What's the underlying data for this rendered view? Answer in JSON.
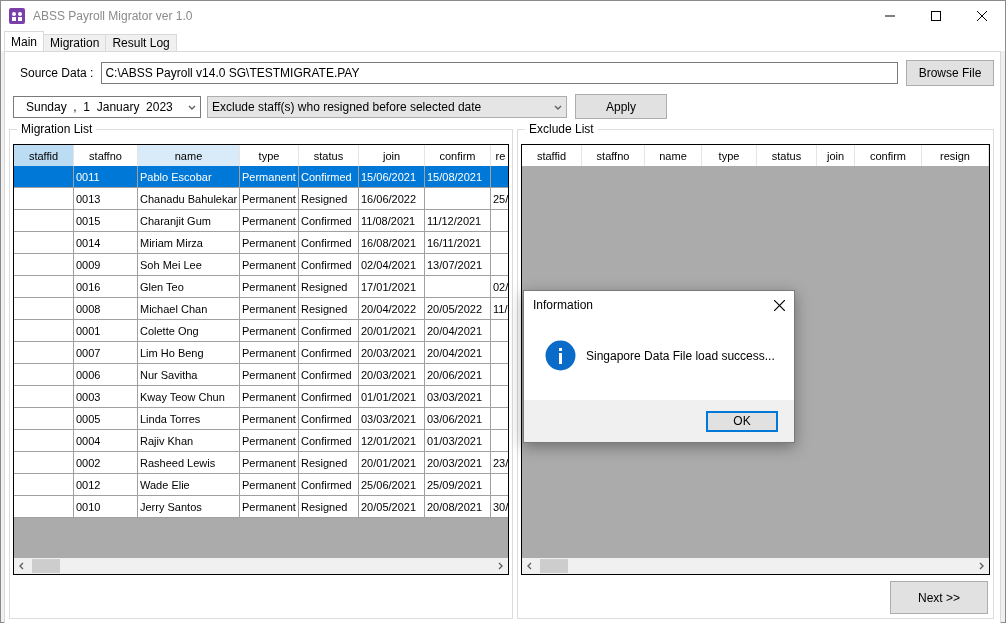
{
  "window": {
    "title": "ABSS Payroll Migrator ver 1.0"
  },
  "tabs": [
    {
      "label": "Main",
      "selected": true
    },
    {
      "label": "Migration",
      "selected": false
    },
    {
      "label": "Result Log",
      "selected": false
    }
  ],
  "source": {
    "label": "Source Data :",
    "value": "C:\\ABSS Payroll v14.0 SG\\TESTMIGRATE.PAY",
    "button": "Browse File"
  },
  "filter": {
    "date": "Sunday  ,  1  January  2023",
    "option": "Exclude staff(s) who resigned before selected date",
    "button": "Apply"
  },
  "migration_list": {
    "title": "Migration List",
    "columns": [
      {
        "label": "staffid",
        "selected": true,
        "hot": false
      },
      {
        "label": "staffno",
        "selected": false,
        "hot": false
      },
      {
        "label": "name",
        "selected": false,
        "hot": true
      },
      {
        "label": "type",
        "selected": false,
        "hot": false
      },
      {
        "label": "status",
        "selected": false,
        "hot": false
      },
      {
        "label": "join",
        "selected": false,
        "hot": false
      },
      {
        "label": "confirm",
        "selected": false,
        "hot": false
      },
      {
        "label": "re",
        "selected": false,
        "hot": false
      }
    ],
    "rows": [
      {
        "selected": true,
        "staffno": "0011",
        "name": "Pablo Escobar",
        "type": "Permanent",
        "status": "Confirmed",
        "join": "15/06/2021",
        "confirm": "15/08/2021"
      },
      {
        "selected": false,
        "staffno": "0013",
        "name": "Chanadu Bahulekar",
        "type": "Permanent",
        "status": "Resigned",
        "join": "16/06/2022",
        "resign": "25/"
      },
      {
        "selected": false,
        "staffno": "0015",
        "name": "Charanjit Gum",
        "type": "Permanent",
        "status": "Confirmed",
        "join": "11/08/2021",
        "confirm": "11/12/2021"
      },
      {
        "selected": false,
        "staffno": "0014",
        "name": "Miriam Mirza",
        "type": "Permanent",
        "status": "Confirmed",
        "join": "16/08/2021",
        "confirm": "16/11/2021"
      },
      {
        "selected": false,
        "staffno": "0009",
        "name": "Soh Mei Lee",
        "type": "Permanent",
        "status": "Confirmed",
        "join": "02/04/2021",
        "confirm": "13/07/2021"
      },
      {
        "selected": false,
        "staffno": "0016",
        "name": "Glen Teo",
        "type": "Permanent",
        "status": "Resigned",
        "join": "17/01/2021",
        "resign": "02/"
      },
      {
        "selected": false,
        "staffno": "0008",
        "name": "Michael Chan",
        "type": "Permanent",
        "status": "Resigned",
        "join": "20/04/2022",
        "confirm": "20/05/2022",
        "resign": "11/"
      },
      {
        "selected": false,
        "staffno": "0001",
        "name": "Colette Ong",
        "type": "Permanent",
        "status": "Confirmed",
        "join": "20/01/2021",
        "confirm": "20/04/2021"
      },
      {
        "selected": false,
        "staffno": "0007",
        "name": "Lim Ho Beng",
        "type": "Permanent",
        "status": "Confirmed",
        "join": "20/03/2021",
        "confirm": "20/04/2021"
      },
      {
        "selected": false,
        "staffno": "0006",
        "name": "Nur Savitha",
        "type": "Permanent",
        "status": "Confirmed",
        "join": "20/03/2021",
        "confirm": "20/06/2021"
      },
      {
        "selected": false,
        "staffno": "0003",
        "name": "Kway Teow Chun",
        "type": "Permanent",
        "status": "Confirmed",
        "join": "01/01/2021",
        "confirm": "03/03/2021"
      },
      {
        "selected": false,
        "staffno": "0005",
        "name": "Linda Torres",
        "type": "Permanent",
        "status": "Confirmed",
        "join": "03/03/2021",
        "confirm": "03/06/2021"
      },
      {
        "selected": false,
        "staffno": "0004",
        "name": "Rajiv Khan",
        "type": "Permanent",
        "status": "Confirmed",
        "join": "12/01/2021",
        "confirm": "01/03/2021"
      },
      {
        "selected": false,
        "staffno": "0002",
        "name": "Rasheed Lewis",
        "type": "Permanent",
        "status": "Resigned",
        "join": "20/01/2021",
        "confirm": "20/03/2021",
        "resign": "23/"
      },
      {
        "selected": false,
        "staffno": "0012",
        "name": "Wade Elie",
        "type": "Permanent",
        "status": "Confirmed",
        "join": "25/06/2021",
        "confirm": "25/09/2021"
      },
      {
        "selected": false,
        "staffno": "0010",
        "name": "Jerry Santos",
        "type": "Permanent",
        "status": "Resigned",
        "join": "20/05/2021",
        "confirm": "20/08/2021",
        "resign": "30/"
      }
    ]
  },
  "exclude_list": {
    "title": "Exclude List",
    "columns": [
      {
        "label": "staffid"
      },
      {
        "label": "staffno"
      },
      {
        "label": "name"
      },
      {
        "label": "type"
      },
      {
        "label": "status"
      },
      {
        "label": "join"
      },
      {
        "label": "confirm"
      },
      {
        "label": "resign"
      }
    ]
  },
  "next_button": "Next >>",
  "dialog": {
    "title": "Information",
    "message": "Singapore Data File load success...",
    "button": "OK"
  }
}
